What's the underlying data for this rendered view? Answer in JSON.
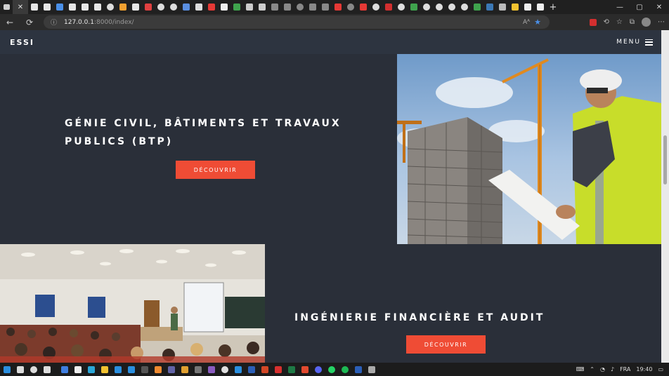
{
  "browser": {
    "tab_close_glyph": "✕",
    "new_tab_glyph": "+",
    "tab_icons": [
      {
        "name": "page-icon",
        "color": "#e6e6e6"
      },
      {
        "name": "page-icon",
        "color": "#e6e6e6"
      },
      {
        "name": "folder-icon",
        "color": "#4a8fe7"
      },
      {
        "name": "page-icon",
        "color": "#e6e6e6"
      },
      {
        "name": "page-icon",
        "color": "#e6e6e6"
      },
      {
        "name": "page-icon",
        "color": "#e6e6e6"
      },
      {
        "name": "search-icon",
        "color": "#dddddd"
      },
      {
        "name": "flame-icon",
        "color": "#f0a030"
      },
      {
        "name": "page-icon",
        "color": "#e6e6e6"
      },
      {
        "name": "pdf-icon",
        "color": "#e04040"
      },
      {
        "name": "search-icon",
        "color": "#dddddd"
      },
      {
        "name": "search-icon",
        "color": "#dddddd"
      },
      {
        "name": "translate-icon",
        "color": "#5a8ee0"
      },
      {
        "name": "speaker-icon",
        "color": "#dddddd"
      },
      {
        "name": "youtube-icon",
        "color": "#e53935"
      },
      {
        "name": "word-icon",
        "color": "#eeeeee"
      },
      {
        "name": "leaf-icon",
        "color": "#3fa34d"
      },
      {
        "name": "page-icon",
        "color": "#cccccc"
      },
      {
        "name": "page-icon",
        "color": "#cccccc"
      },
      {
        "name": "page-icon",
        "color": "#888888"
      },
      {
        "name": "page-icon",
        "color": "#888888"
      },
      {
        "name": "globe-icon",
        "color": "#888888"
      },
      {
        "name": "page-icon",
        "color": "#888888"
      },
      {
        "name": "page-icon",
        "color": "#888888"
      },
      {
        "name": "youtube-icon",
        "color": "#e53935"
      },
      {
        "name": "globe-icon",
        "color": "#888888"
      },
      {
        "name": "youtube-icon",
        "color": "#e53935"
      },
      {
        "name": "search-icon",
        "color": "#dddddd"
      },
      {
        "name": "j-icon",
        "color": "#d32f2f"
      },
      {
        "name": "search-icon",
        "color": "#dddddd"
      },
      {
        "name": "leaf-icon",
        "color": "#3fa34d"
      },
      {
        "name": "search-icon",
        "color": "#dddddd"
      },
      {
        "name": "search-icon",
        "color": "#dddddd"
      },
      {
        "name": "search-icon",
        "color": "#dddddd"
      },
      {
        "name": "search-icon",
        "color": "#dddddd"
      },
      {
        "name": "leaf-icon",
        "color": "#3fa34d"
      },
      {
        "name": "python-icon",
        "color": "#3b78b5"
      },
      {
        "name": "grid-icon",
        "color": "#bbbbbb"
      },
      {
        "name": "python-icon",
        "color": "#f2c230"
      },
      {
        "name": "medium-icon",
        "color": "#eeeeee"
      },
      {
        "name": "medium-icon",
        "color": "#eeeeee"
      }
    ],
    "window_controls": {
      "minimize": "—",
      "maximize": "▢",
      "close": "✕"
    },
    "back_glyph": "←",
    "refresh_glyph": "⟳",
    "info_glyph": "ⓘ",
    "url_host": "127.0.0.1",
    "url_rest": ":8000/index/",
    "read_aloud": "Aᴬ",
    "favorite_glyph": "★",
    "accent": "#4a8fe7"
  },
  "site": {
    "brand": "ESSI",
    "menu_label": "MENU",
    "section1": {
      "title": "GÉNIE CIVIL, BÂTIMENTS ET TRAVAUX PUBLICS (BTP)",
      "button": "DÉCOUVRIR"
    },
    "section2": {
      "title": "INGÉNIERIE FINANCIÈRE ET AUDIT",
      "button": "DÉCOUVRIR"
    },
    "colors": {
      "background": "#2a2f39",
      "button": "#ef4c35",
      "nav": "#2d3440"
    }
  },
  "taskbar": {
    "icons": [
      {
        "name": "windows-start-icon",
        "color": "#2b8fe0"
      },
      {
        "name": "search-icon",
        "color": "#dddddd"
      },
      {
        "name": "cortana-icon",
        "color": "#dddddd"
      },
      {
        "name": "task-view-icon",
        "color": "#dddddd"
      },
      {
        "name": "shield-icon",
        "color": "#3f7ee0"
      },
      {
        "name": "github-icon",
        "color": "#eeeeee"
      },
      {
        "name": "edge-icon",
        "color": "#2aa7d8"
      },
      {
        "name": "file-explorer-icon",
        "color": "#f2c230"
      },
      {
        "name": "vscode-icon",
        "color": "#2a8fe0"
      },
      {
        "name": "mail-icon",
        "color": "#2a8fe0"
      },
      {
        "name": "terminal-icon",
        "color": "#555555"
      },
      {
        "name": "sublime-icon",
        "color": "#f08a30"
      },
      {
        "name": "teams-icon",
        "color": "#6264a7"
      },
      {
        "name": "slack-icon",
        "color": "#e0a030"
      },
      {
        "name": "app-icon",
        "color": "#777777"
      },
      {
        "name": "visual-studio-icon",
        "color": "#8a5cc0"
      },
      {
        "name": "chrome-icon",
        "color": "#e0e0e0"
      },
      {
        "name": "store-icon",
        "color": "#2a8fe0"
      },
      {
        "name": "word-icon",
        "color": "#2b5fb8"
      },
      {
        "name": "powerpoint-icon",
        "color": "#d24726"
      },
      {
        "name": "acrobat-icon",
        "color": "#d8302f"
      },
      {
        "name": "excel-icon",
        "color": "#1e7a45"
      },
      {
        "name": "git-icon",
        "color": "#e24a2f"
      },
      {
        "name": "discord-icon",
        "color": "#5865f2"
      },
      {
        "name": "whatsapp-icon",
        "color": "#25d366"
      },
      {
        "name": "spotify-icon",
        "color": "#1db954"
      },
      {
        "name": "word-icon",
        "color": "#2b5fb8"
      },
      {
        "name": "remote-desktop-icon",
        "color": "#aaaaaa"
      }
    ],
    "language": "FRA",
    "time": "19:40"
  }
}
